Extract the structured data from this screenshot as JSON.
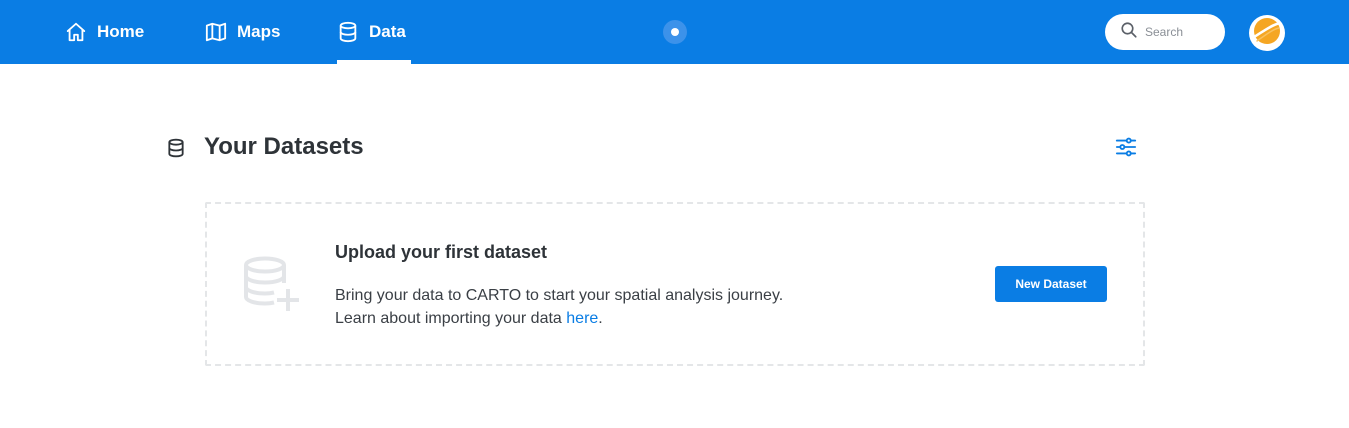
{
  "nav": {
    "items": [
      {
        "label": "Home",
        "icon": "home-icon"
      },
      {
        "label": "Maps",
        "icon": "map-icon"
      },
      {
        "label": "Data",
        "icon": "database-icon",
        "active": true
      }
    ]
  },
  "search": {
    "placeholder": "Search"
  },
  "page": {
    "title": "Your Datasets"
  },
  "empty_state": {
    "title": "Upload your first dataset",
    "line1": "Bring your data to CARTO to start your spatial analysis journey.",
    "line2_prefix": "Learn about importing your data ",
    "link_text": "here",
    "line2_suffix": ".",
    "button_label": "New Dataset"
  },
  "colors": {
    "brand": "#0a7de4",
    "text": "#2e3338",
    "avatar": "#f5a623"
  }
}
